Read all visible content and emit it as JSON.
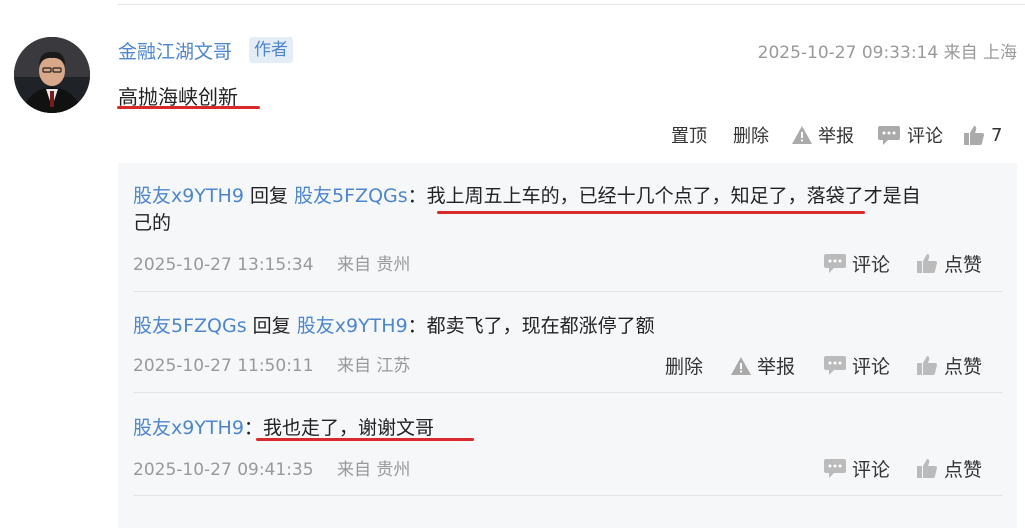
{
  "post": {
    "author": "金融江湖文哥",
    "badge": "作者",
    "timestamp": "2025-10-27 09:33:14",
    "location": "来自 上海",
    "text": "高抛海峡创新",
    "actions": {
      "pin": "置顶",
      "delete": "删除",
      "report": "举报",
      "comment": "评论",
      "like_count": "7"
    }
  },
  "replies": [
    {
      "user": "股友x9YTH9",
      "reply_word": "回复",
      "target": "股友5FZQGs",
      "colon": "：",
      "text_line1": "我上周五上车的，已经十几个点了，知足了，落袋了才是自",
      "text_line2": "己的",
      "timestamp": "2025-10-27 13:15:34",
      "location": "来自 贵州",
      "comment": "评论",
      "like": "点赞"
    },
    {
      "user": "股友5FZQGs",
      "reply_word": "回复",
      "target": "股友x9YTH9",
      "colon": "：",
      "text": "都卖飞了，现在都涨停了额",
      "timestamp": "2025-10-27 11:50:11",
      "location": "来自 江苏",
      "delete": "删除",
      "report": "举报",
      "comment": "评论",
      "like": "点赞"
    },
    {
      "user": "股友x9YTH9",
      "colon": "：",
      "text": "我也走了，谢谢文哥",
      "timestamp": "2025-10-27 09:41:35",
      "location": "来自 贵州",
      "comment": "评论",
      "like": "点赞"
    }
  ],
  "colors": {
    "link": "#4d86cc",
    "underline": "#d8292c",
    "meta": "#999999"
  },
  "icons": [
    "warning-icon",
    "comment-icon",
    "thumbs-up-icon"
  ]
}
